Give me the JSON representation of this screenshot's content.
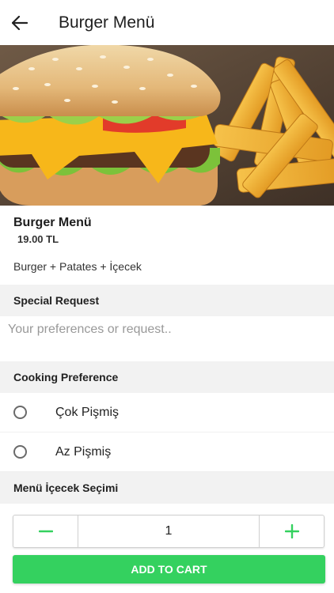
{
  "header": {
    "title": "Burger Menü",
    "back_icon": "arrow-left-icon"
  },
  "item": {
    "name": "Burger Menü",
    "price": "19.00 TL",
    "description": "Burger + Patates + İçecek"
  },
  "special_request": {
    "title": "Special Request",
    "placeholder": "Your preferences or request.."
  },
  "cooking": {
    "title": "Cooking Preference",
    "options": [
      {
        "label": "Çok Pişmiş",
        "selected": false
      },
      {
        "label": "Az Pişmiş",
        "selected": false
      }
    ]
  },
  "drink": {
    "title": "Menü İçecek Seçimi"
  },
  "quantity": {
    "value": "1",
    "minus_icon": "minus-icon",
    "plus_icon": "plus-icon"
  },
  "cart": {
    "label": "ADD TO CART"
  },
  "colors": {
    "accent": "#34d15f",
    "section_bg": "#f2f2f2"
  }
}
